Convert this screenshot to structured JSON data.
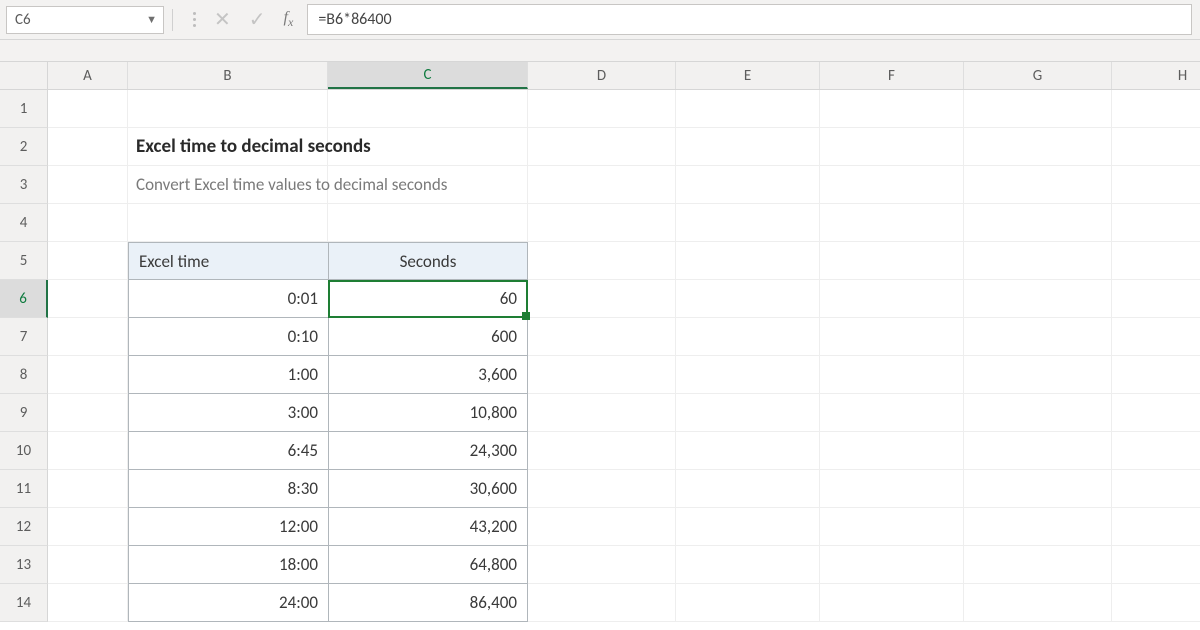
{
  "namebox": {
    "value": "C6"
  },
  "formula": {
    "value": "=B6*86400"
  },
  "columns": [
    "",
    "A",
    "B",
    "C",
    "D",
    "E",
    "F",
    "G",
    "H"
  ],
  "rows": [
    "1",
    "2",
    "3",
    "4",
    "5",
    "6",
    "7",
    "8",
    "9",
    "10",
    "11",
    "12",
    "13",
    "14"
  ],
  "active": {
    "row": "6",
    "col": "C"
  },
  "content": {
    "title": "Excel time to decimal seconds",
    "subtitle": "Convert Excel time values to decimal seconds",
    "headers": {
      "b": "Excel time",
      "c": "Seconds"
    },
    "data": [
      {
        "time": "0:01",
        "seconds": "60"
      },
      {
        "time": "0:10",
        "seconds": "600"
      },
      {
        "time": "1:00",
        "seconds": "3,600"
      },
      {
        "time": "3:00",
        "seconds": "10,800"
      },
      {
        "time": "6:45",
        "seconds": "24,300"
      },
      {
        "time": "8:30",
        "seconds": "30,600"
      },
      {
        "time": "12:00",
        "seconds": "43,200"
      },
      {
        "time": "18:00",
        "seconds": "64,800"
      },
      {
        "time": "24:00",
        "seconds": "86,400"
      }
    ]
  },
  "chart_data": {
    "type": "table",
    "title": "Excel time to decimal seconds",
    "columns": [
      "Excel time",
      "Seconds"
    ],
    "rows": [
      [
        "0:01",
        60
      ],
      [
        "0:10",
        600
      ],
      [
        "1:00",
        3600
      ],
      [
        "3:00",
        10800
      ],
      [
        "6:45",
        24300
      ],
      [
        "8:30",
        30600
      ],
      [
        "12:00",
        43200
      ],
      [
        "18:00",
        64800
      ],
      [
        "24:00",
        86400
      ]
    ]
  }
}
